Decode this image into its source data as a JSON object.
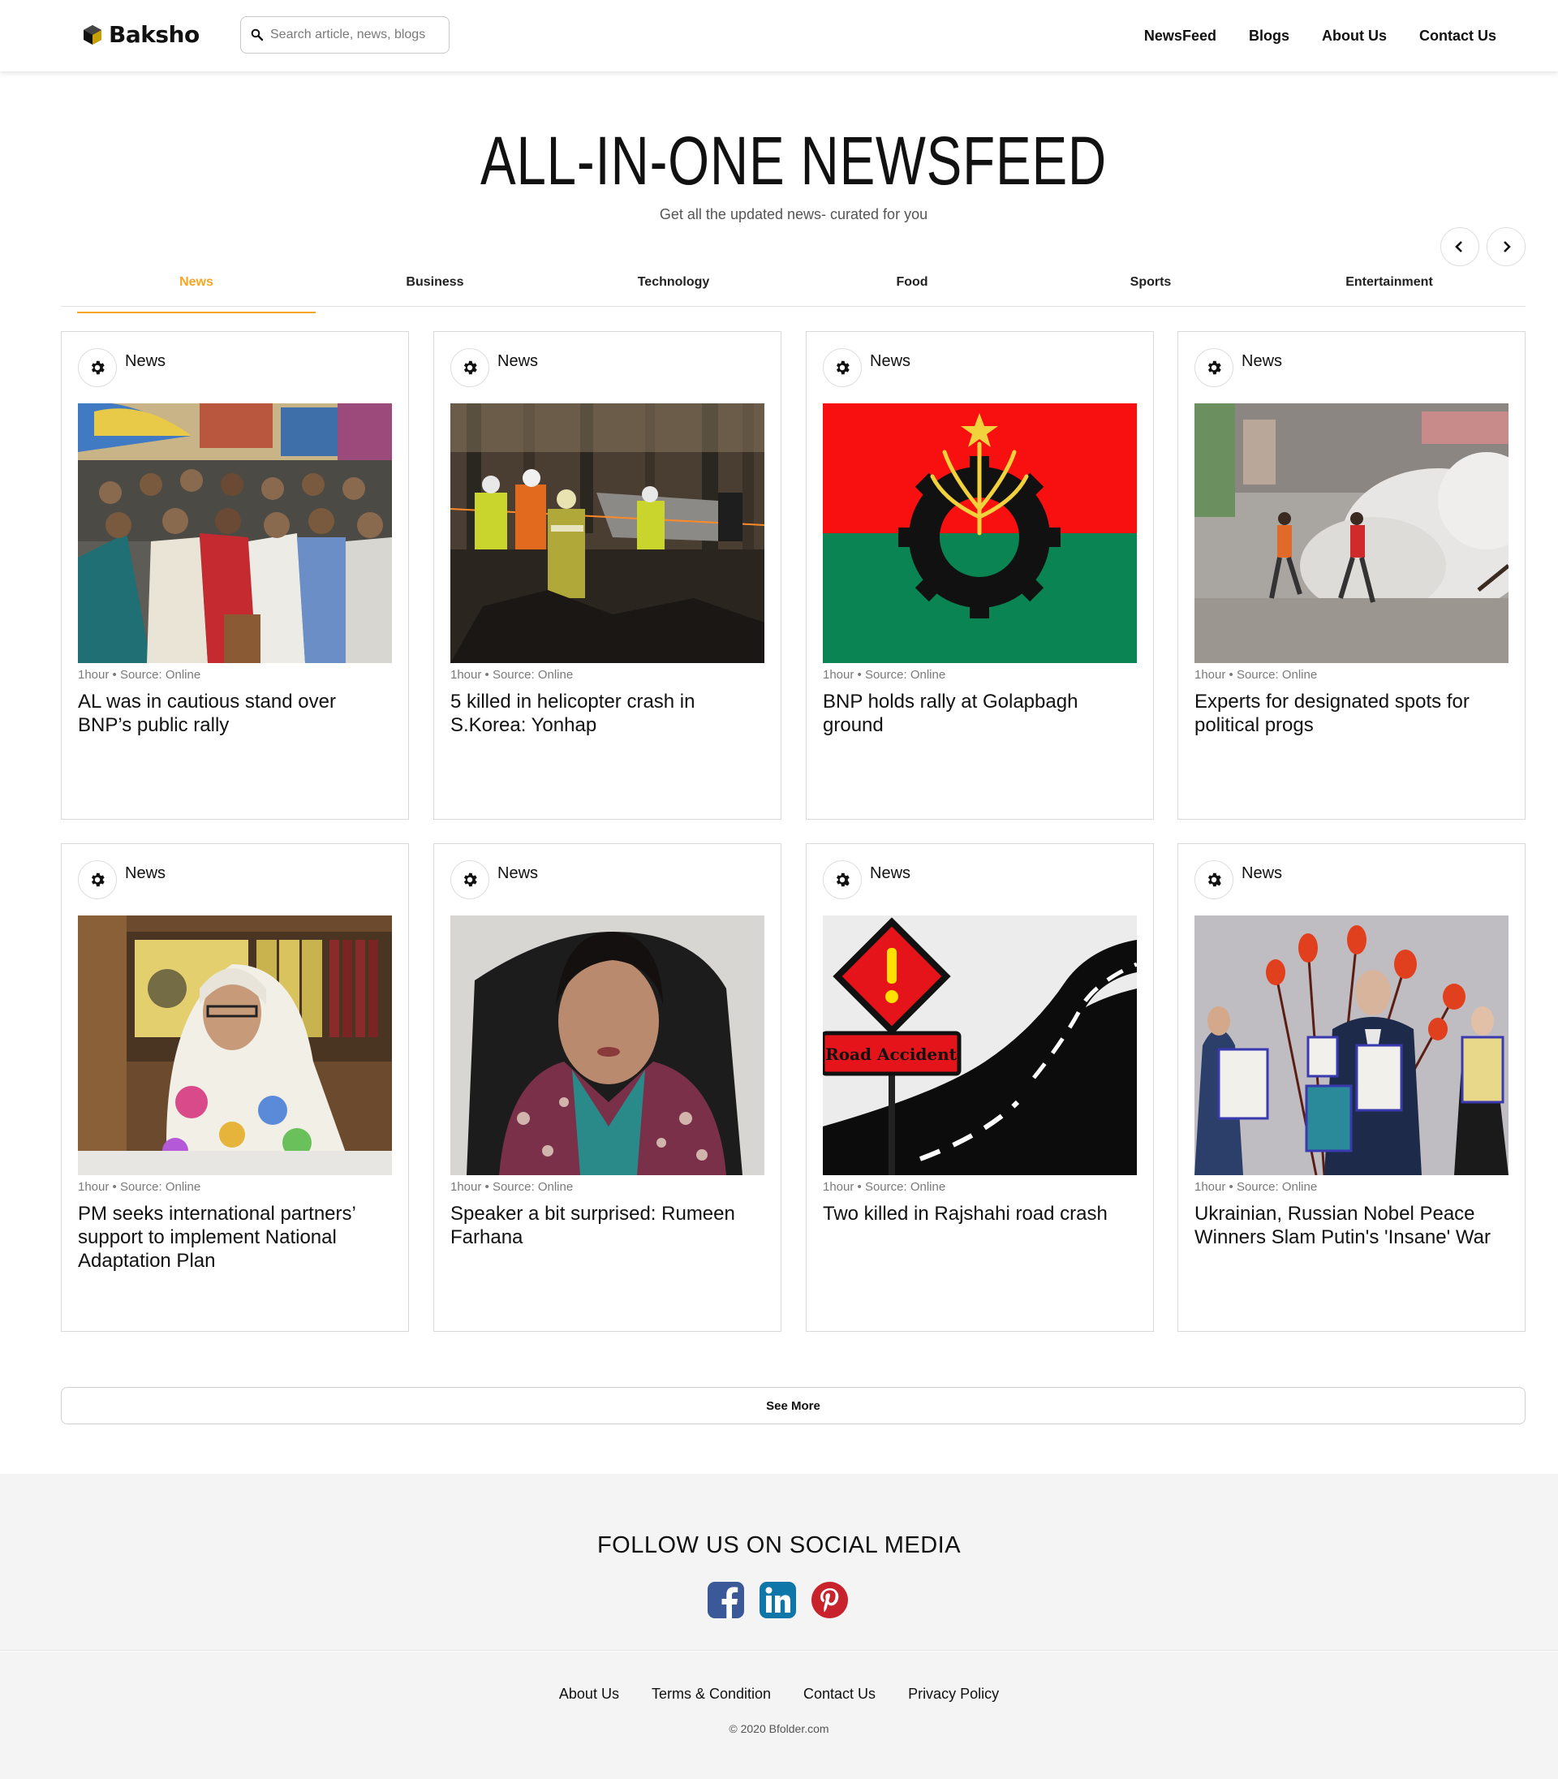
{
  "header": {
    "brand": "Baksho",
    "search_placeholder": "Search article, news, blogs",
    "nav": [
      "NewsFeed",
      "Blogs",
      "About Us",
      "Contact Us"
    ]
  },
  "hero": {
    "title": "ALL-IN-ONE NEWSFEED",
    "subtitle": "Get all the updated news- curated for you"
  },
  "tabs": [
    "News",
    "Business",
    "Technology",
    "Food",
    "Sports",
    "Entertainment"
  ],
  "active_tab": "News",
  "accent_color": "#f5a623",
  "cards": [
    {
      "category": "News",
      "meta": "1hour • Source: Online",
      "title": "AL was in cautious stand over BNP’s public rally",
      "image": "rally-crowd-photo"
    },
    {
      "category": "News",
      "meta": "1hour • Source: Online",
      "title": "5 killed in helicopter crash in S.Korea: Yonhap",
      "image": "helicopter-crash-photo"
    },
    {
      "category": "News",
      "meta": "1hour • Source: Online",
      "title": "BNP holds rally at Golapbagh ground",
      "image": "bnp-flag"
    },
    {
      "category": "News",
      "meta": "1hour • Source: Online",
      "title": "Experts for designated spots for political progs",
      "image": "street-clash-photo"
    },
    {
      "category": "News",
      "meta": "1hour • Source: Online",
      "title": "PM seeks international partners’ support to implement National Adaptation Plan",
      "image": "pm-portrait-photo"
    },
    {
      "category": "News",
      "meta": "1hour • Source: Online",
      "title": "Speaker a bit surprised: Rumeen Farhana",
      "image": "speaker-portrait-photo"
    },
    {
      "category": "News",
      "meta": "1hour • Source: Online",
      "title": "Two killed in Rajshahi road crash",
      "image": "road-accident-illustration",
      "image_text": "Road Accident"
    },
    {
      "category": "News",
      "meta": "1hour • Source: Online",
      "title": "Ukrainian, Russian Nobel Peace Winners Slam Putin's 'Insane' War",
      "image": "nobel-ceremony-photo"
    }
  ],
  "see_more": "See More",
  "footer": {
    "follow": "FOLLOW US ON SOCIAL MEDIA",
    "social": [
      "facebook-icon",
      "linkedin-icon",
      "pinterest-icon"
    ],
    "links": [
      "About Us",
      "Terms & Condition",
      "Contact Us",
      "Privacy Policy"
    ],
    "copyright": "© 2020 Bfolder.com"
  }
}
